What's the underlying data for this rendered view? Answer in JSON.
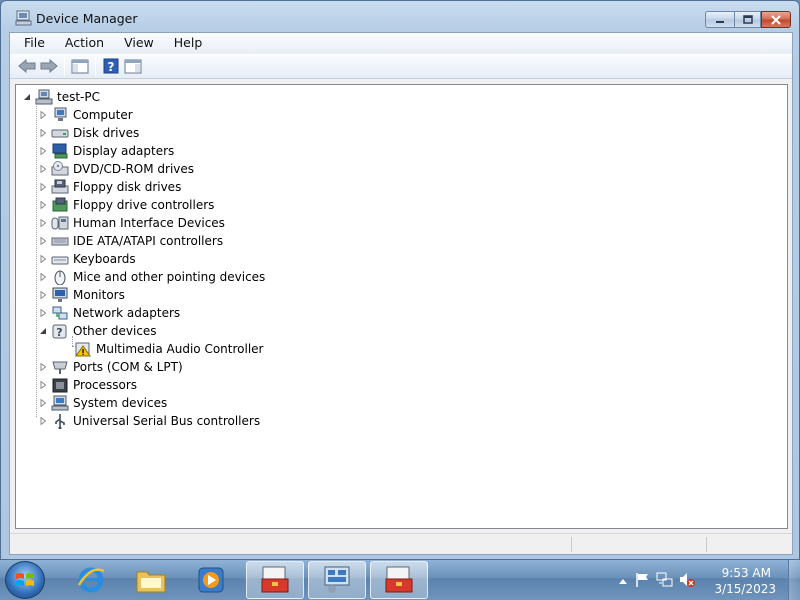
{
  "window": {
    "title": "Device Manager",
    "title_icon": "device-manager-icon"
  },
  "menu": [
    "File",
    "Action",
    "View",
    "Help"
  ],
  "toolbar": {
    "buttons": [
      "back-arrow-icon",
      "forward-arrow-icon",
      "show-hide-console-tree-icon",
      "help-icon",
      "properties-icon"
    ]
  },
  "tree": {
    "root": {
      "label": "test-PC",
      "icon": "computer-root-icon",
      "expanded": true
    },
    "categories": [
      {
        "label": "Computer",
        "icon": "computer-icon",
        "expanded": false
      },
      {
        "label": "Disk drives",
        "icon": "disk-drive-icon",
        "expanded": false
      },
      {
        "label": "Display adapters",
        "icon": "display-adapter-icon",
        "expanded": false
      },
      {
        "label": "DVD/CD-ROM drives",
        "icon": "dvd-drive-icon",
        "expanded": false
      },
      {
        "label": "Floppy disk drives",
        "icon": "floppy-disk-icon",
        "expanded": false
      },
      {
        "label": "Floppy drive controllers",
        "icon": "floppy-controller-icon",
        "expanded": false
      },
      {
        "label": "Human Interface Devices",
        "icon": "hid-icon",
        "expanded": false
      },
      {
        "label": "IDE ATA/ATAPI controllers",
        "icon": "ide-controller-icon",
        "expanded": false
      },
      {
        "label": "Keyboards",
        "icon": "keyboard-icon",
        "expanded": false
      },
      {
        "label": "Mice and other pointing devices",
        "icon": "mouse-icon",
        "expanded": false
      },
      {
        "label": "Monitors",
        "icon": "monitor-icon",
        "expanded": false
      },
      {
        "label": "Network adapters",
        "icon": "network-adapter-icon",
        "expanded": false
      },
      {
        "label": "Other devices",
        "icon": "other-devices-icon",
        "expanded": true,
        "children": [
          {
            "label": "Multimedia Audio Controller",
            "icon": "warning-device-icon"
          }
        ]
      },
      {
        "label": "Ports (COM & LPT)",
        "icon": "port-icon",
        "expanded": false
      },
      {
        "label": "Processors",
        "icon": "processor-icon",
        "expanded": false
      },
      {
        "label": "System devices",
        "icon": "system-device-icon",
        "expanded": false
      },
      {
        "label": "Universal Serial Bus controllers",
        "icon": "usb-icon",
        "expanded": false
      }
    ]
  },
  "taskbar": {
    "apps": [
      "internet-explorer-icon",
      "windows-explorer-icon",
      "media-player-icon",
      "toolbox-app-icon",
      "device-manager-app-icon",
      "toolbox-app-icon-2"
    ],
    "tray_icons": [
      "show-hidden-icons-arrow",
      "action-center-flag-icon",
      "network-icon",
      "volume-muted-icon"
    ],
    "clock_time": "9:53 AM",
    "clock_date": "3/15/2023"
  },
  "colors": {
    "window_frame": "#b6cde5",
    "close_button": "#c0452b",
    "taskbar": "#6a90b8",
    "warning": "#f5c400"
  }
}
